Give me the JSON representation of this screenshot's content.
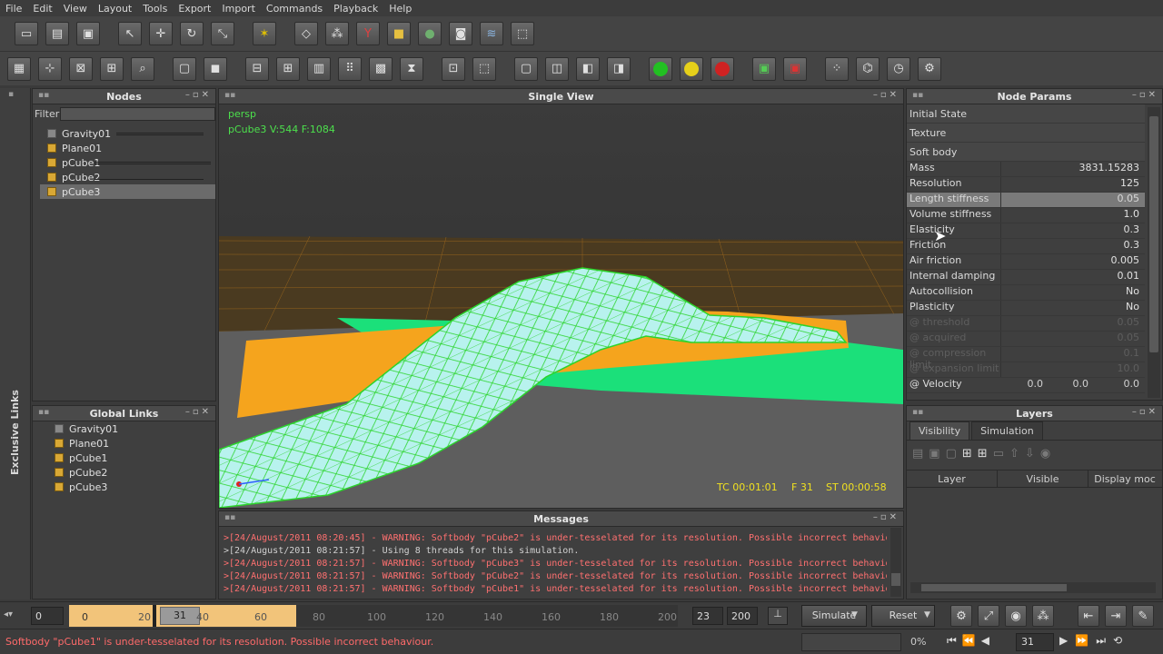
{
  "menu": [
    "File",
    "Edit",
    "View",
    "Layout",
    "Tools",
    "Export",
    "Import",
    "Commands",
    "Playback",
    "Help"
  ],
  "nodes_panel": {
    "title": "Nodes",
    "filter_label": "Filter",
    "filter_value": "",
    "items": [
      "Gravity01",
      "Plane01",
      "pCube1",
      "pCube2",
      "pCube3"
    ],
    "selected": "pCube3"
  },
  "links_panel": {
    "title": "Global Links",
    "items": [
      "Gravity01",
      "Plane01",
      "pCube1",
      "pCube2",
      "pCube3"
    ]
  },
  "side_tab": "Exclusive Links",
  "viewport": {
    "title": "Single View",
    "camera": "persp",
    "stats": "pCube3 V:544 F:1084",
    "tc": "TC 00:01:01",
    "frame": "F 31",
    "st": "ST 00:00:58"
  },
  "params_panel": {
    "title": "Node Params",
    "sections": [
      "Initial State",
      "Texture",
      "Soft body"
    ],
    "rows": [
      {
        "name": "Mass",
        "value": "3831.15283"
      },
      {
        "name": "Resolution",
        "value": "125"
      },
      {
        "name": "Length stiffness",
        "value": "0.05"
      },
      {
        "name": "Volume stiffness",
        "value": "1.0"
      },
      {
        "name": "Elasticity",
        "value": "0.3"
      },
      {
        "name": "Friction",
        "value": "0.3"
      },
      {
        "name": "Air friction",
        "value": "0.005"
      },
      {
        "name": "Internal damping",
        "value": "0.01"
      },
      {
        "name": "Autocollision",
        "value": "No"
      },
      {
        "name": "Plasticity",
        "value": "No"
      },
      {
        "name": "@ threshold",
        "value": "0.05"
      },
      {
        "name": "@ acquired",
        "value": "0.05"
      },
      {
        "name": "@ compression limit",
        "value": "0.1"
      },
      {
        "name": "@ expansion limit",
        "value": "10.0"
      }
    ],
    "velocity": {
      "name": "@ Velocity",
      "x": "0.0",
      "y": "0.0",
      "z": "0.0"
    }
  },
  "layers_panel": {
    "title": "Layers",
    "tabs": [
      "Visibility",
      "Simulation"
    ],
    "columns": [
      "Layer",
      "Visible",
      "Display moc"
    ]
  },
  "messages_panel": {
    "title": "Messages",
    "lines": [
      {
        "text": ">[24/August/2011 08:20:45] - WARNING: Softbody \"pCube2\" is under-tesselated for its resolution. Possible incorrect behaviour.",
        "type": "warn"
      },
      {
        "text": ">[24/August/2011 08:21:57] - Using 8 threads for this simulation.",
        "type": "info"
      },
      {
        "text": ">[24/August/2011 08:21:57] - WARNING: Softbody \"pCube3\" is under-tesselated for its resolution. Possible incorrect behaviour.",
        "type": "warn"
      },
      {
        "text": ">[24/August/2011 08:21:57] - WARNING: Softbody \"pCube2\" is under-tesselated for its resolution. Possible incorrect behaviour.",
        "type": "warn"
      },
      {
        "text": ">[24/August/2011 08:21:57] - WARNING: Softbody \"pCube1\" is under-tesselated for its resolution. Possible incorrect behaviour.",
        "type": "warn"
      }
    ]
  },
  "timeline": {
    "start": "0",
    "range_start": "0",
    "current": "31",
    "ticks": [
      "0",
      "20",
      "40",
      "60",
      "80",
      "100",
      "120",
      "140",
      "160",
      "180",
      "200"
    ],
    "end_a": "23",
    "end_b": "200",
    "simulate_label": "Simulate",
    "reset_label": "Reset"
  },
  "status": {
    "message": "Softbody \"pCube1\" is under-tesselated for its resolution. Possible incorrect behaviour.",
    "progress": "0%",
    "frame": "31"
  }
}
